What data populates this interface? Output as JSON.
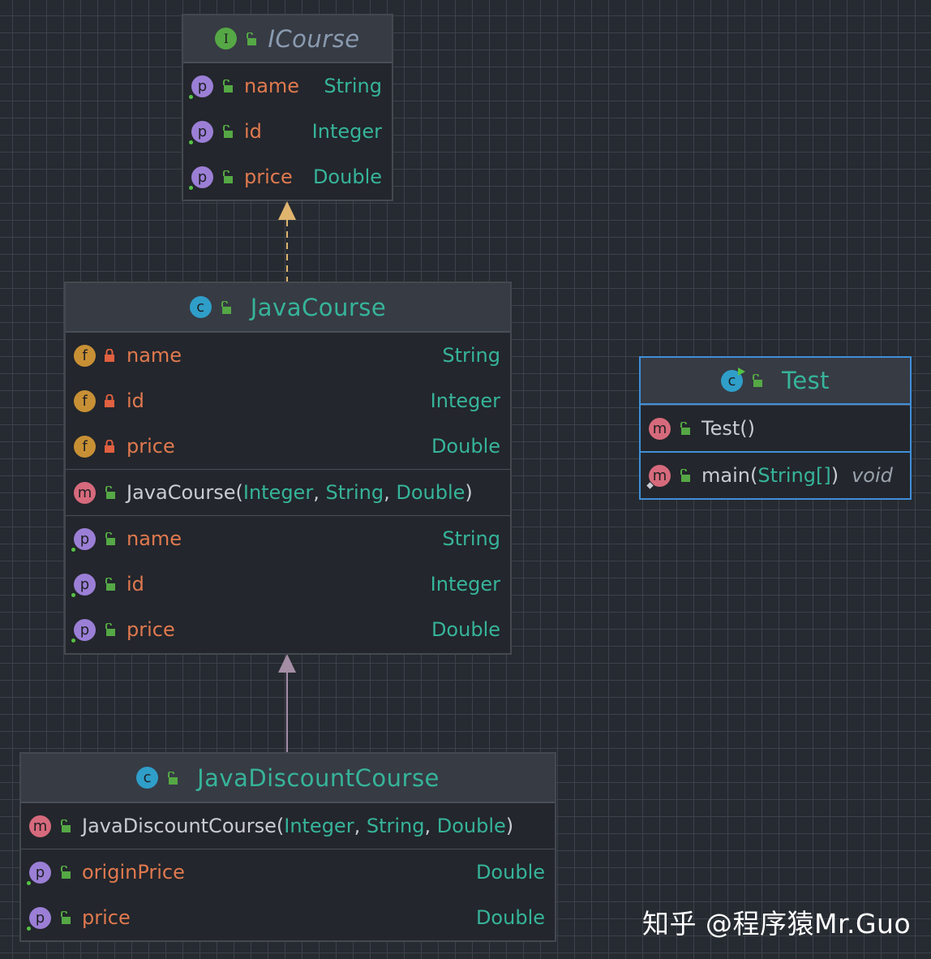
{
  "nodes": {
    "icourse": {
      "title": "ICourse",
      "kind_letter": "I",
      "props": [
        {
          "kind": "p",
          "name": "name",
          "type": "String"
        },
        {
          "kind": "p",
          "name": "id",
          "type": "Integer"
        },
        {
          "kind": "p",
          "name": "price",
          "type": "Double"
        }
      ]
    },
    "javacourse": {
      "title": "JavaCourse",
      "kind_letter": "c",
      "fields": [
        {
          "kind": "f",
          "name": "name",
          "type": "String"
        },
        {
          "kind": "f",
          "name": "id",
          "type": "Integer"
        },
        {
          "kind": "f",
          "name": "price",
          "type": "Double"
        }
      ],
      "constructor": {
        "name": "JavaCourse",
        "open": "(",
        "p1": "Integer",
        "sep1": ", ",
        "p2": "String",
        "sep2": ", ",
        "p3": "Double",
        "close": ")"
      },
      "props": [
        {
          "kind": "p",
          "name": "name",
          "type": "String"
        },
        {
          "kind": "p",
          "name": "id",
          "type": "Integer"
        },
        {
          "kind": "p",
          "name": "price",
          "type": "Double"
        }
      ]
    },
    "test": {
      "title": "Test",
      "kind_letter": "c",
      "constructor": {
        "name": "Test",
        "parens": "()"
      },
      "main": {
        "name": "main",
        "open": "(",
        "param": "String[]",
        "close": ")",
        "ret": "void"
      }
    },
    "javadiscountcourse": {
      "title": "JavaDiscountCourse",
      "kind_letter": "c",
      "constructor": {
        "name": "JavaDiscountCourse",
        "open": "(",
        "p1": "Integer",
        "sep1": ", ",
        "p2": "String",
        "sep2": ", ",
        "p3": "Double",
        "close": ")"
      },
      "props": [
        {
          "kind": "p",
          "name": "originPrice",
          "type": "Double"
        },
        {
          "kind": "p",
          "name": "price",
          "type": "Double"
        }
      ]
    }
  },
  "icons": {
    "property": "p-badge-icon",
    "field": "f-badge-icon",
    "method": "m-badge-icon",
    "class": "c-badge-icon",
    "interface": "i-badge-icon",
    "public": "open-lock-icon",
    "private": "closed-lock-icon"
  },
  "colors": {
    "background": "#262a31",
    "grid": "#3d424b",
    "node_fill": "#23262c",
    "header_fill": "#373b44",
    "class_title": "#36b49a",
    "member_name": "#e0794f",
    "type": "#36b49a",
    "implements_arrow": "#e0b56e",
    "extends_arrow": "#a48ea6",
    "selected_border": "#3f8fd8"
  },
  "watermark": "知乎 @程序猿Mr.Guo"
}
